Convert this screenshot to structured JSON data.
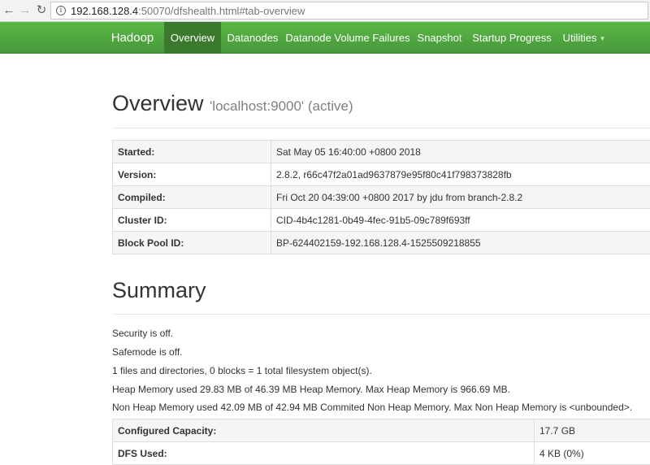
{
  "browser": {
    "url_host": "192.168.128.4",
    "url_rest": ":50070/dfshealth.html#tab-overview"
  },
  "nav": {
    "brand": "Hadoop",
    "items": [
      {
        "label": "Overview",
        "active": true
      },
      {
        "label": "Datanodes"
      },
      {
        "label": "Datanode Volume Failures"
      },
      {
        "label": "Snapshot"
      },
      {
        "label": "Startup Progress"
      },
      {
        "label": "Utilities"
      }
    ]
  },
  "overview": {
    "title": "Overview",
    "subtitle": "'localhost:9000' (active)",
    "rows": [
      {
        "key": "Started:",
        "value": "Sat May 05 16:40:00 +0800 2018"
      },
      {
        "key": "Version:",
        "value": "2.8.2, r66c47f2a01ad9637879e95f80c41f798373828fb"
      },
      {
        "key": "Compiled:",
        "value": "Fri Oct 20 04:39:00 +0800 2017 by jdu from branch-2.8.2"
      },
      {
        "key": "Cluster ID:",
        "value": "CID-4b4c1281-0b49-4fec-91b5-09c789f693ff"
      },
      {
        "key": "Block Pool ID:",
        "value": "BP-624402159-192.168.128.4-1525509218855"
      }
    ]
  },
  "summary": {
    "title": "Summary",
    "lines": [
      "Security is off.",
      "Safemode is off.",
      "1 files and directories, 0 blocks = 1 total filesystem object(s).",
      "Heap Memory used 29.83 MB of 46.39 MB Heap Memory. Max Heap Memory is 966.69 MB.",
      "Non Heap Memory used 42.09 MB of 42.94 MB Commited Non Heap Memory. Max Non Heap Memory is <unbounded>."
    ],
    "capacity_rows": [
      {
        "key": "Configured Capacity:",
        "value": "17.7 GB"
      },
      {
        "key": "DFS Used:",
        "value": "4 KB (0%)"
      }
    ]
  }
}
